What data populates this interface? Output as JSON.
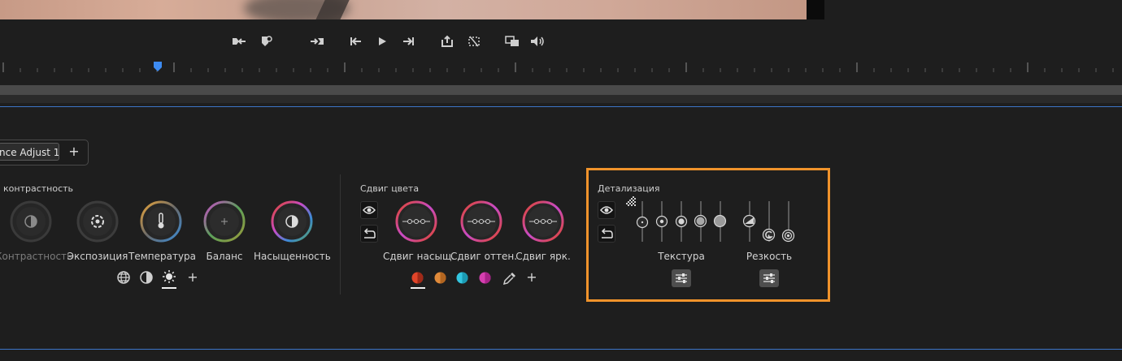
{
  "tab": {
    "label": "nce Adjust 1",
    "add_label": "+"
  },
  "light": {
    "section_title": "контрастность",
    "knobs": [
      {
        "label": "Контрастность",
        "state": "disabled"
      },
      {
        "label": "Экспозиция"
      },
      {
        "label": "Температура"
      },
      {
        "label": "Баланс"
      },
      {
        "label": "Насыщенность"
      }
    ],
    "add_label": "+"
  },
  "color_shift": {
    "section_title": "Сдвиг цвета",
    "knobs": [
      {
        "label": "Сдвиг насыщ."
      },
      {
        "label": "Сдвиг оттен."
      },
      {
        "label": "Сдвиг ярк."
      }
    ],
    "swatches": [
      "#e0452a",
      "#e08a3a",
      "#33c6e0",
      "#d63fb0"
    ],
    "add_label": "+"
  },
  "detail": {
    "section_title": "Детализация",
    "groups": [
      {
        "label": "Текстура"
      },
      {
        "label": "Резкость"
      }
    ]
  },
  "colors": {
    "accent": "#f0932b",
    "timeline_line": "#3d75c7",
    "playhead": "#3d8bf2"
  }
}
